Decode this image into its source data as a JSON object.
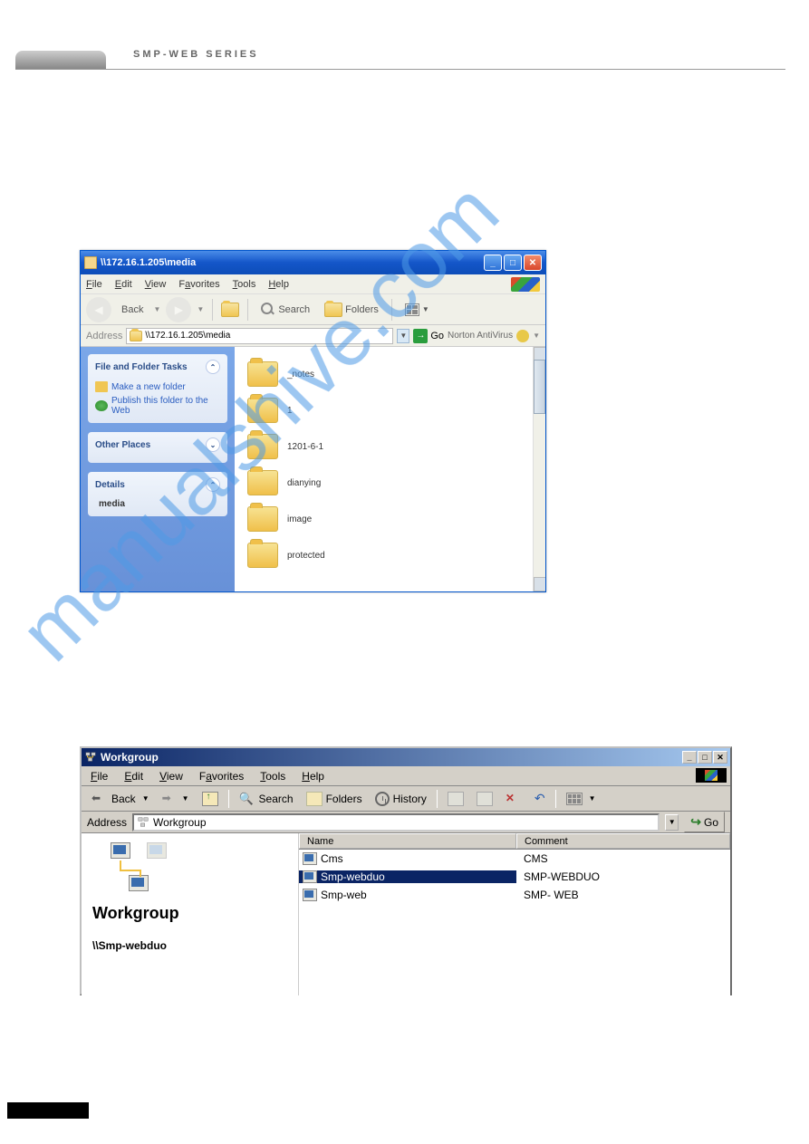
{
  "page_header": {
    "title": "SMP-WEB SERIES"
  },
  "watermark": "manualshive.com",
  "xp": {
    "title": "\\\\172.16.1.205\\media",
    "menu": [
      "File",
      "Edit",
      "View",
      "Favorites",
      "Tools",
      "Help"
    ],
    "toolbar": {
      "back": "Back",
      "search": "Search",
      "folders": "Folders"
    },
    "address": {
      "label": "Address",
      "value": "\\\\172.16.1.205\\media",
      "go": "Go",
      "nav": "Norton AntiVirus"
    },
    "sidebar": {
      "panel1": {
        "title": "File and Folder Tasks",
        "links": [
          "Make a new folder",
          "Publish this folder to the Web"
        ]
      },
      "panel2": {
        "title": "Other Places"
      },
      "panel3": {
        "title": "Details",
        "subtitle": "media"
      }
    },
    "folders": [
      "_notes",
      "1",
      "1201-6-1",
      "dianying",
      "image",
      "protected"
    ]
  },
  "w2k": {
    "title": "Workgroup",
    "menu": [
      "File",
      "Edit",
      "View",
      "Favorites",
      "Tools",
      "Help"
    ],
    "toolbar": {
      "back": "Back",
      "search": "Search",
      "folders": "Folders",
      "history": "History"
    },
    "address": {
      "label": "Address",
      "value": "Workgroup",
      "go": "Go"
    },
    "left": {
      "title": "Workgroup",
      "path": "\\\\Smp-webduo"
    },
    "columns": [
      "Name",
      "Comment"
    ],
    "rows": [
      {
        "name": "Cms",
        "comment": "CMS",
        "selected": false
      },
      {
        "name": "Smp-webduo",
        "comment": "SMP-WEBDUO",
        "selected": true
      },
      {
        "name": "Smp-web",
        "comment": "SMP- WEB",
        "selected": false
      }
    ]
  }
}
